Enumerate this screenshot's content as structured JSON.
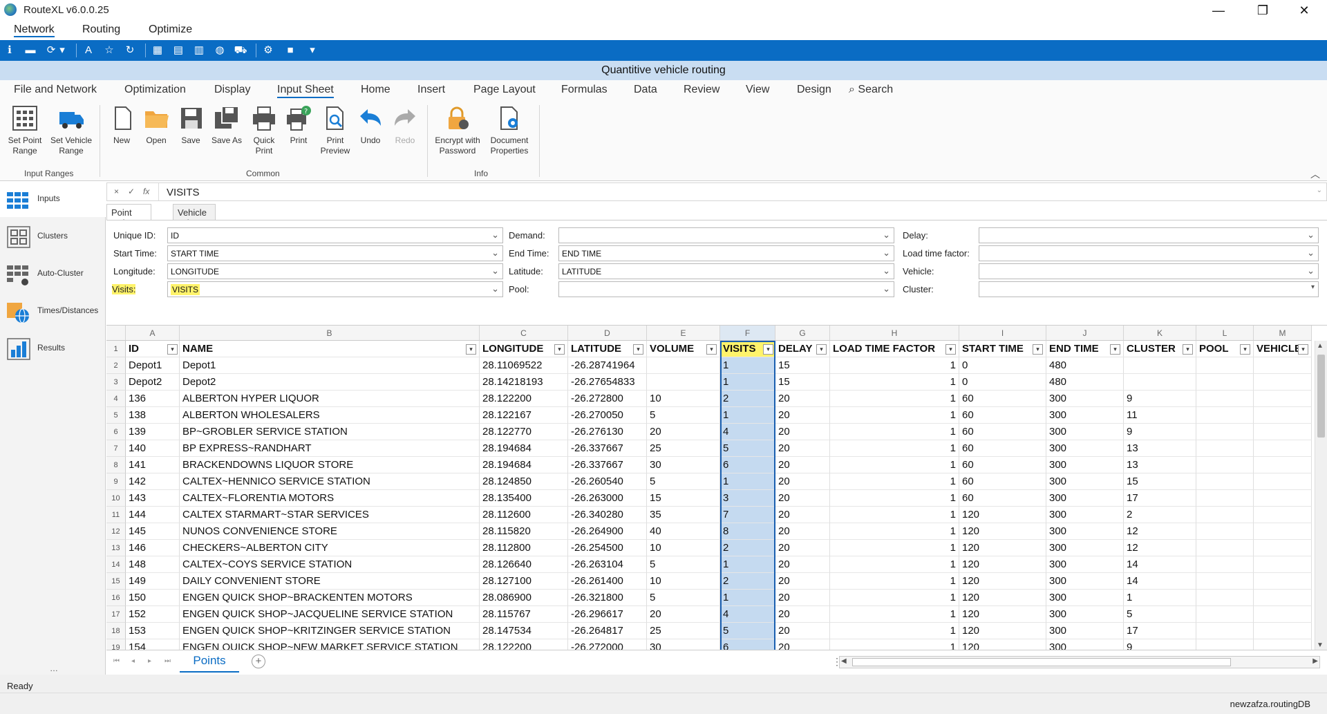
{
  "window": {
    "title": "RouteXL v6.0.0.25",
    "minimize": "—",
    "maximize": "❐",
    "close": "✕"
  },
  "menu": [
    "Network",
    "Routing",
    "Optimize"
  ],
  "subtitle": "Quantitive vehicle routing",
  "ribbon_tabs": [
    "File and Network",
    "Optimization",
    "Display",
    "Input Sheet",
    "Home",
    "Insert",
    "Page Layout",
    "Formulas",
    "Data",
    "Review",
    "View",
    "Design",
    "Search"
  ],
  "ribbon": {
    "input_ranges": {
      "label": "Input Ranges",
      "set_point_range": "Set Point\nRange",
      "set_vehicle_range": "Set Vehicle\nRange"
    },
    "common": {
      "label": "Common",
      "new": "New",
      "open": "Open",
      "save": "Save",
      "save_as": "Save As",
      "quick_print": "Quick\nPrint",
      "print": "Print",
      "print_preview": "Print\nPreview",
      "undo": "Undo",
      "redo": "Redo"
    },
    "info": {
      "label": "Info",
      "encrypt": "Encrypt with\nPassword",
      "doc_props": "Document\nProperties"
    }
  },
  "nav": [
    "Inputs",
    "Clusters",
    "Auto-Cluster",
    "Times/Distances",
    "Results"
  ],
  "formula": {
    "cancel": "×",
    "confirm": "✓",
    "fx": "fx",
    "value": "VISITS"
  },
  "column_tabs": [
    "Point Columns",
    "Vehicle columns"
  ],
  "mapping": {
    "unique_id": {
      "label": "Unique ID:",
      "value": "ID"
    },
    "start_time": {
      "label": "Start Time:",
      "value": "START TIME"
    },
    "longitude": {
      "label": "Longitude:",
      "value": "LONGITUDE"
    },
    "visits": {
      "label": "Visits:",
      "value": "VISITS"
    },
    "demand": {
      "label": "Demand:",
      "value": ""
    },
    "end_time": {
      "label": "End Time:",
      "value": "END TIME"
    },
    "latitude": {
      "label": "Latitude:",
      "value": "LATITUDE"
    },
    "pool": {
      "label": "Pool:",
      "value": ""
    },
    "delay": {
      "label": "Delay:",
      "value": ""
    },
    "load_time_factor": {
      "label": "Load time factor:",
      "value": ""
    },
    "vehicle": {
      "label": "Vehicle:",
      "value": ""
    },
    "cluster": {
      "label": "Cluster:",
      "value": ""
    }
  },
  "sheet": {
    "col_letters": [
      "A",
      "B",
      "C",
      "D",
      "E",
      "F",
      "G",
      "H",
      "I",
      "J",
      "K",
      "L",
      "M"
    ],
    "headers": [
      "ID",
      "NAME",
      "LONGITUDE",
      "LATITUDE",
      "VOLUME",
      "VISITS",
      "DELAY",
      "LOAD TIME FACTOR",
      "START TIME",
      "END TIME",
      "CLUSTER",
      "POOL",
      "VEHICLE"
    ],
    "row_numbers": [
      "1",
      "2",
      "3",
      "4",
      "5",
      "6",
      "7",
      "8",
      "9",
      "10",
      "11",
      "12",
      "13",
      "14",
      "15",
      "16",
      "17",
      "18",
      "19"
    ],
    "rows": [
      [
        "Depot1",
        "Depot1",
        "28.11069522",
        "-26.28741964",
        "",
        "1",
        "15",
        "1",
        "0",
        "480",
        "",
        "",
        ""
      ],
      [
        "Depot2",
        "Depot2",
        "28.14218193",
        "-26.27654833",
        "",
        "1",
        "15",
        "1",
        "0",
        "480",
        "",
        "",
        ""
      ],
      [
        "136",
        "ALBERTON HYPER LIQUOR",
        "28.122200",
        "-26.272800",
        "10",
        "2",
        "20",
        "1",
        "60",
        "300",
        "9",
        "",
        ""
      ],
      [
        "138",
        "ALBERTON WHOLESALERS",
        "28.122167",
        "-26.270050",
        "5",
        "1",
        "20",
        "1",
        "60",
        "300",
        "11",
        "",
        ""
      ],
      [
        "139",
        "BP~GROBLER SERVICE STATION",
        "28.122770",
        "-26.276130",
        "20",
        "4",
        "20",
        "1",
        "60",
        "300",
        "9",
        "",
        ""
      ],
      [
        "140",
        "BP EXPRESS~RANDHART",
        "28.194684",
        "-26.337667",
        "25",
        "5",
        "20",
        "1",
        "60",
        "300",
        "13",
        "",
        ""
      ],
      [
        "141",
        "BRACKENDOWNS LIQUOR STORE",
        "28.194684",
        "-26.337667",
        "30",
        "6",
        "20",
        "1",
        "60",
        "300",
        "13",
        "",
        ""
      ],
      [
        "142",
        "CALTEX~HENNICO SERVICE STATION",
        "28.124850",
        "-26.260540",
        "5",
        "1",
        "20",
        "1",
        "60",
        "300",
        "15",
        "",
        ""
      ],
      [
        "143",
        "CALTEX~FLORENTIA MOTORS",
        "28.135400",
        "-26.263000",
        "15",
        "3",
        "20",
        "1",
        "60",
        "300",
        "17",
        "",
        ""
      ],
      [
        "144",
        "CALTEX STARMART~STAR SERVICES",
        "28.112600",
        "-26.340280",
        "35",
        "7",
        "20",
        "1",
        "120",
        "300",
        "2",
        "",
        ""
      ],
      [
        "145",
        "NUNOS CONVENIENCE STORE",
        "28.115820",
        "-26.264900",
        "40",
        "8",
        "20",
        "1",
        "120",
        "300",
        "12",
        "",
        ""
      ],
      [
        "146",
        "CHECKERS~ALBERTON CITY",
        "28.112800",
        "-26.254500",
        "10",
        "2",
        "20",
        "1",
        "120",
        "300",
        "12",
        "",
        ""
      ],
      [
        "148",
        "CALTEX~COYS SERVICE STATION",
        "28.126640",
        "-26.263104",
        "5",
        "1",
        "20",
        "1",
        "120",
        "300",
        "14",
        "",
        ""
      ],
      [
        "149",
        "DAILY CONVENIENT STORE",
        "28.127100",
        "-26.261400",
        "10",
        "2",
        "20",
        "1",
        "120",
        "300",
        "14",
        "",
        ""
      ],
      [
        "150",
        "ENGEN QUICK SHOP~BRACKENTEN MOTORS",
        "28.086900",
        "-26.321800",
        "5",
        "1",
        "20",
        "1",
        "120",
        "300",
        "1",
        "",
        ""
      ],
      [
        "152",
        "ENGEN QUICK SHOP~JACQUELINE SERVICE STATION",
        "28.115767",
        "-26.296617",
        "20",
        "4",
        "20",
        "1",
        "120",
        "300",
        "5",
        "",
        ""
      ],
      [
        "153",
        "ENGEN QUICK SHOP~KRITZINGER SERVICE STATION",
        "28.147534",
        "-26.264817",
        "25",
        "5",
        "20",
        "1",
        "120",
        "300",
        "17",
        "",
        ""
      ],
      [
        "154",
        "ENGEN QUICK SHOP~NEW MARKET SERVICE STATION",
        "28.122200",
        "-26.272000",
        "30",
        "6",
        "20",
        "1",
        "120",
        "300",
        "9",
        "",
        ""
      ]
    ]
  },
  "sheet_tab": "Points",
  "status": {
    "left": "Ready",
    "right": "newzafza.routingDB"
  },
  "colors": {
    "accent": "#0a6cc4",
    "highlight": "#fff36b",
    "selected_col": "#c5daf0"
  }
}
